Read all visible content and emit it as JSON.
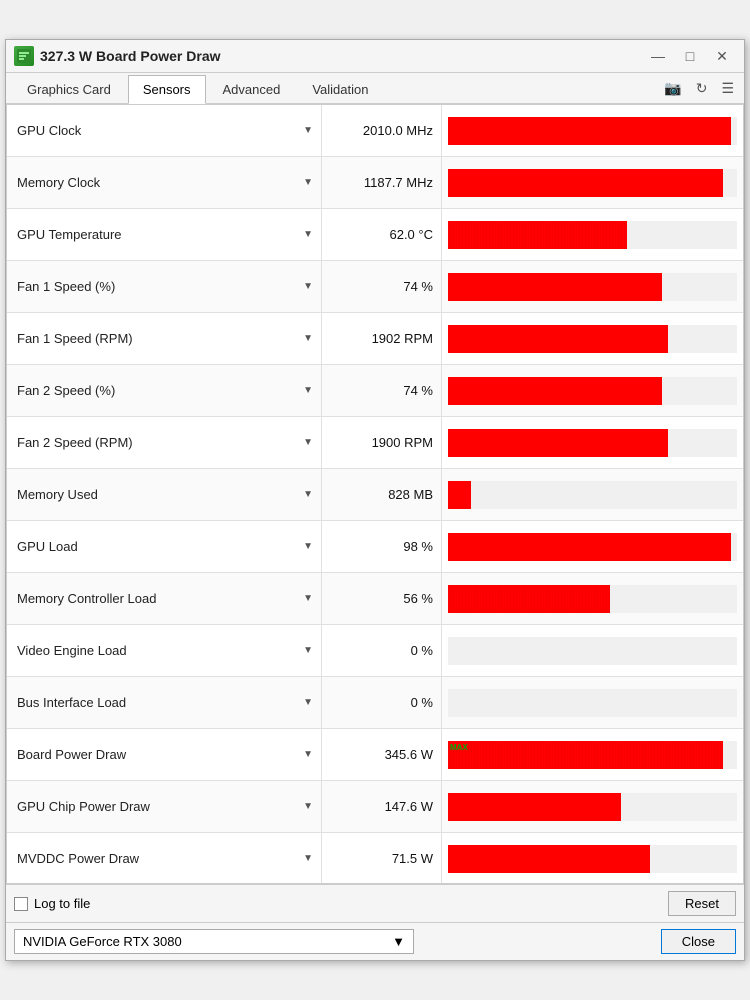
{
  "window": {
    "title": "327.3 W Board Power Draw",
    "icon_label": "GPU"
  },
  "title_controls": {
    "minimize": "—",
    "maximize": "□",
    "close": "✕"
  },
  "tabs": [
    {
      "id": "graphics-card",
      "label": "Graphics Card",
      "active": false
    },
    {
      "id": "sensors",
      "label": "Sensors",
      "active": true
    },
    {
      "id": "advanced",
      "label": "Advanced",
      "active": false
    },
    {
      "id": "validation",
      "label": "Validation",
      "active": false
    }
  ],
  "toolbar_icons": {
    "camera": "📷",
    "refresh": "↻",
    "menu": "☰"
  },
  "sensors": [
    {
      "name": "GPU Clock",
      "value": "2010.0 MHz",
      "bar_pct": 98,
      "noisy": false,
      "has_max": false
    },
    {
      "name": "Memory Clock",
      "value": "1187.7 MHz",
      "bar_pct": 95,
      "noisy": false,
      "has_max": false
    },
    {
      "name": "GPU Temperature",
      "value": "62.0 °C",
      "bar_pct": 62,
      "noisy": true,
      "has_max": false
    },
    {
      "name": "Fan 1 Speed (%)",
      "value": "74 %",
      "bar_pct": 74,
      "noisy": false,
      "has_max": false
    },
    {
      "name": "Fan 1 Speed (RPM)",
      "value": "1902 RPM",
      "bar_pct": 76,
      "noisy": false,
      "has_max": false
    },
    {
      "name": "Fan 2 Speed (%)",
      "value": "74 %",
      "bar_pct": 74,
      "noisy": false,
      "has_max": false
    },
    {
      "name": "Fan 2 Speed (RPM)",
      "value": "1900 RPM",
      "bar_pct": 76,
      "noisy": false,
      "has_max": false
    },
    {
      "name": "Memory Used",
      "value": "828 MB",
      "bar_pct": 8,
      "noisy": false,
      "has_max": false
    },
    {
      "name": "GPU Load",
      "value": "98 %",
      "bar_pct": 98,
      "noisy": false,
      "has_max": false
    },
    {
      "name": "Memory Controller Load",
      "value": "56 %",
      "bar_pct": 56,
      "noisy": true,
      "has_max": false
    },
    {
      "name": "Video Engine Load",
      "value": "0 %",
      "bar_pct": 0,
      "noisy": false,
      "has_max": false
    },
    {
      "name": "Bus Interface Load",
      "value": "0 %",
      "bar_pct": 0,
      "noisy": false,
      "has_max": false
    },
    {
      "name": "Board Power Draw",
      "value": "345.6 W",
      "bar_pct": 95,
      "noisy": true,
      "has_max": true
    },
    {
      "name": "GPU Chip Power Draw",
      "value": "147.6 W",
      "bar_pct": 60,
      "noisy": false,
      "has_max": false
    },
    {
      "name": "MVDDC Power Draw",
      "value": "71.5 W",
      "bar_pct": 70,
      "noisy": false,
      "has_max": false
    }
  ],
  "bottom": {
    "log_to_file_label": "Log to file",
    "reset_label": "Reset"
  },
  "footer": {
    "gpu_name": "NVIDIA GeForce RTX 3080",
    "close_label": "Close"
  }
}
